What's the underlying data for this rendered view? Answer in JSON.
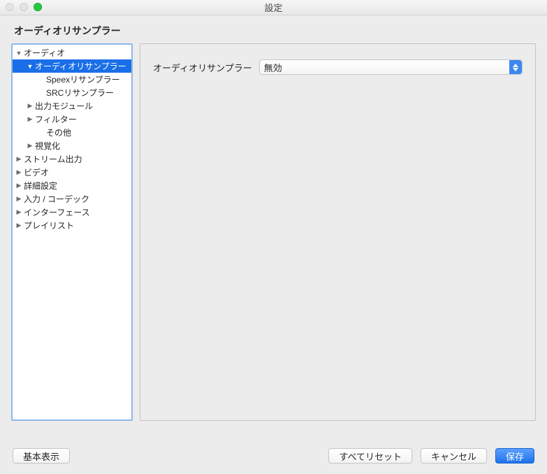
{
  "window": {
    "title": "設定"
  },
  "section_title": "オーディオリサンプラー",
  "tree": {
    "items": [
      {
        "label": "オーディオ",
        "indent": 0,
        "arrow": "down",
        "selected": false
      },
      {
        "label": "オーディオリサンプラー",
        "indent": 1,
        "arrow": "down",
        "selected": true
      },
      {
        "label": "Speexリサンプラー",
        "indent": 2,
        "arrow": "none",
        "selected": false
      },
      {
        "label": "SRCリサンプラー",
        "indent": 2,
        "arrow": "none",
        "selected": false
      },
      {
        "label": "出力モジュール",
        "indent": 1,
        "arrow": "right",
        "selected": false
      },
      {
        "label": "フィルター",
        "indent": 1,
        "arrow": "right",
        "selected": false
      },
      {
        "label": "その他",
        "indent": 2,
        "arrow": "none",
        "selected": false
      },
      {
        "label": "視覚化",
        "indent": 1,
        "arrow": "right",
        "selected": false
      },
      {
        "label": "ストリーム出力",
        "indent": 0,
        "arrow": "right",
        "selected": false
      },
      {
        "label": "ビデオ",
        "indent": 0,
        "arrow": "right",
        "selected": false
      },
      {
        "label": "詳細設定",
        "indent": 0,
        "arrow": "right",
        "selected": false
      },
      {
        "label": "入力 / コーデック",
        "indent": 0,
        "arrow": "right",
        "selected": false
      },
      {
        "label": "インターフェース",
        "indent": 0,
        "arrow": "right",
        "selected": false
      },
      {
        "label": "プレイリスト",
        "indent": 0,
        "arrow": "right",
        "selected": false
      }
    ]
  },
  "form": {
    "resampler_label": "オーディオリサンプラー",
    "resampler_value": "無効"
  },
  "buttons": {
    "basic_view": "基本表示",
    "reset_all": "すべてリセット",
    "cancel": "キャンセル",
    "save": "保存"
  }
}
